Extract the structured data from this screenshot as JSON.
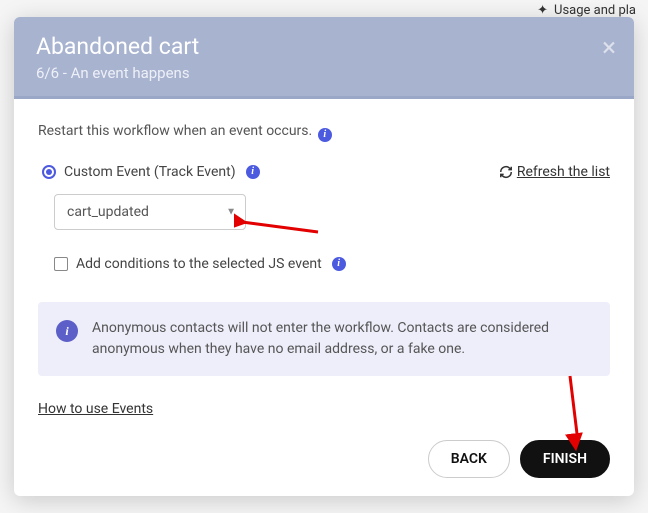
{
  "background": {
    "usage_text": "Usage and pla"
  },
  "header": {
    "title": "Abandoned cart",
    "subtitle": "6/6 - An event happens"
  },
  "body": {
    "restart_text": "Restart this workflow when an event occurs.",
    "radio_label": "Custom Event (Track Event)",
    "refresh_label": " Refresh the list",
    "select_value": "cart_updated",
    "checkbox_label": "Add conditions to the selected JS event",
    "notice_text": "Anonymous contacts will not enter the workflow. Contacts are considered anonymous when they have no email address, or a fake one.",
    "howto_label": "How to use Events"
  },
  "footer": {
    "back_label": "BACK",
    "finish_label": "FINISH"
  }
}
